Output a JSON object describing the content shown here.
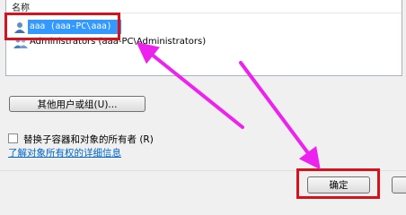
{
  "list": {
    "column_header": "名称",
    "items": [
      {
        "text": "aaa (aaa-PC\\aaa)",
        "selected": true,
        "icon": "user-icon"
      },
      {
        "text": "Administrators (aaa-PC\\Administrators)",
        "selected": false,
        "icon": "group-icon"
      }
    ]
  },
  "buttons": {
    "other_users": "其他用户或组(U)...",
    "ok": "确定"
  },
  "checkbox": {
    "label": "替换子容器和对象的所有者 (R)",
    "checked": false
  },
  "link": {
    "text": "了解对象所有权的详细信息"
  },
  "colors": {
    "highlight_box": "#d6121c",
    "arrow": "#ee22ee",
    "selection": "#3399ff",
    "link": "#0066cc"
  }
}
